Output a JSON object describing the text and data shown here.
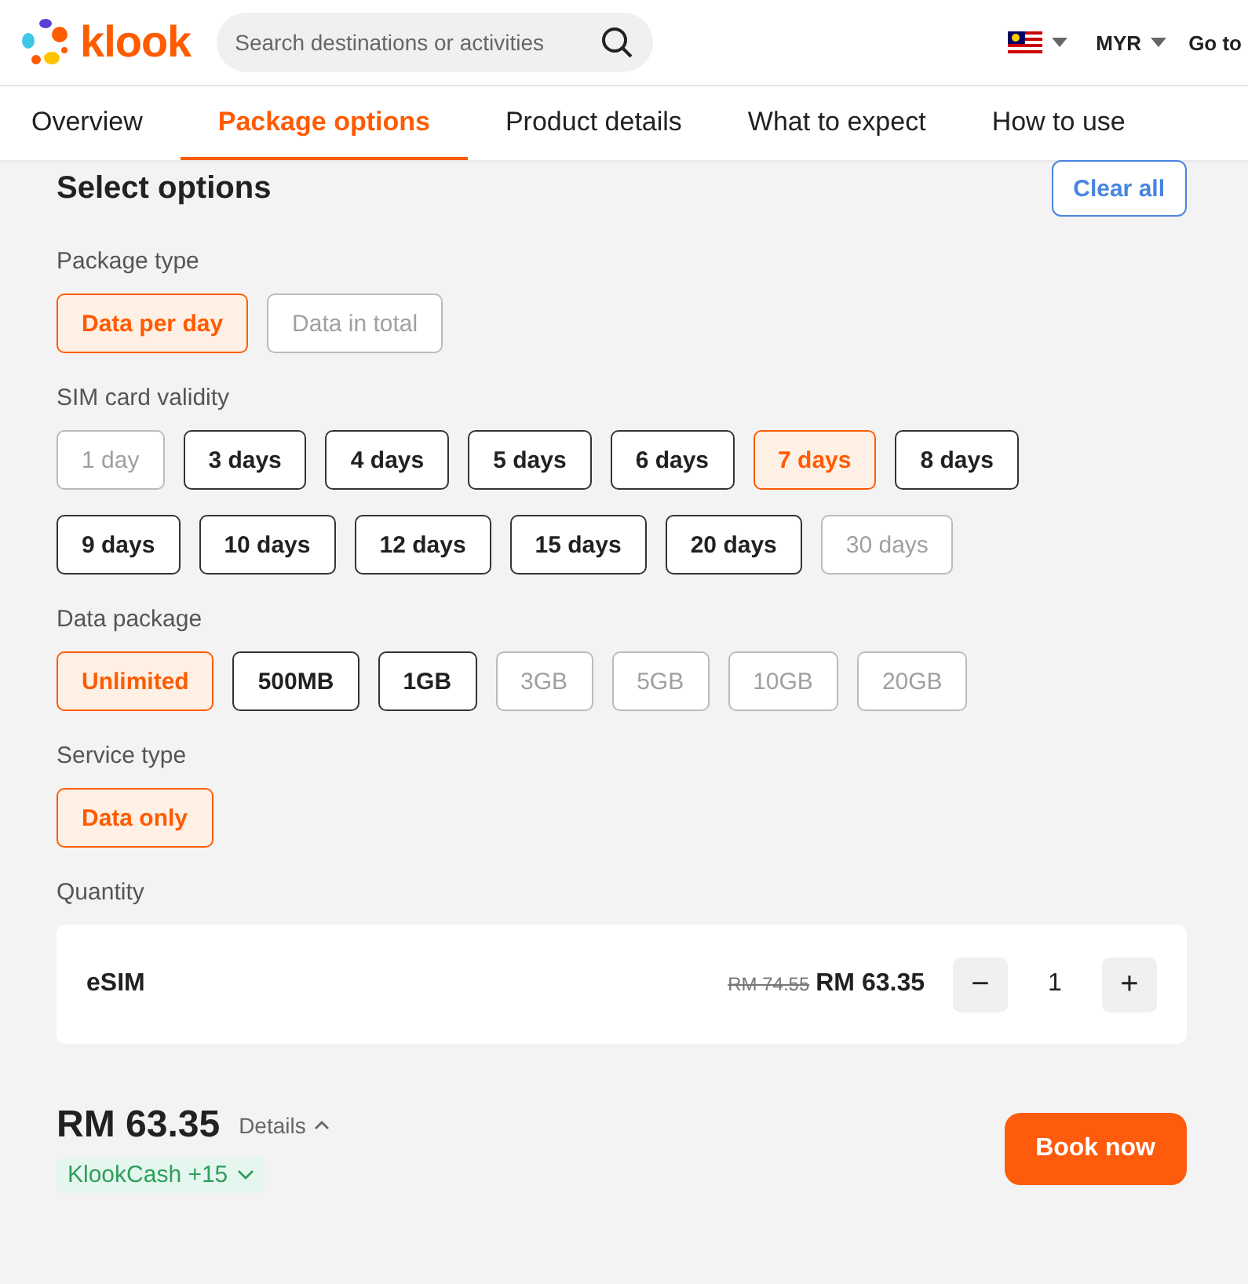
{
  "header": {
    "brand": "klook",
    "search": {
      "placeholder": "Search destinations or activities"
    },
    "currency": "MYR",
    "link": "Go to"
  },
  "tabs": [
    {
      "label": "Overview",
      "selected": false
    },
    {
      "label": "Package options",
      "selected": true
    },
    {
      "label": "Product details",
      "selected": false
    },
    {
      "label": "What to expect",
      "selected": false
    },
    {
      "label": "How to use",
      "selected": false
    }
  ],
  "title": "Select options",
  "clear_button": "Clear all",
  "groups": [
    {
      "label": "Package type",
      "options": [
        {
          "label": "Data per day",
          "selected": true,
          "disabled": false
        },
        {
          "label": "Data in total",
          "selected": false,
          "disabled": true
        }
      ]
    },
    {
      "label": "SIM card validity",
      "options": [
        {
          "label": "1 day",
          "selected": false,
          "disabled": true
        },
        {
          "label": "3 days",
          "selected": false,
          "disabled": false
        },
        {
          "label": "4 days",
          "selected": false,
          "disabled": false
        },
        {
          "label": "5 days",
          "selected": false,
          "disabled": false
        },
        {
          "label": "6 days",
          "selected": false,
          "disabled": false
        },
        {
          "label": "7 days",
          "selected": true,
          "disabled": false
        },
        {
          "label": "8 days",
          "selected": false,
          "disabled": false
        },
        {
          "label": "9 days",
          "selected": false,
          "disabled": false
        },
        {
          "label": "10 days",
          "selected": false,
          "disabled": false
        },
        {
          "label": "12 days",
          "selected": false,
          "disabled": false
        },
        {
          "label": "15 days",
          "selected": false,
          "disabled": false
        },
        {
          "label": "20 days",
          "selected": false,
          "disabled": false
        },
        {
          "label": "30 days",
          "selected": false,
          "disabled": true
        }
      ]
    },
    {
      "label": "Data package",
      "options": [
        {
          "label": "Unlimited",
          "selected": true,
          "disabled": false
        },
        {
          "label": "500MB",
          "selected": false,
          "disabled": false
        },
        {
          "label": "1GB",
          "selected": false,
          "disabled": false
        },
        {
          "label": "3GB",
          "selected": false,
          "disabled": true
        },
        {
          "label": "5GB",
          "selected": false,
          "disabled": true
        },
        {
          "label": "10GB",
          "selected": false,
          "disabled": true
        },
        {
          "label": "20GB",
          "selected": false,
          "disabled": true
        }
      ]
    },
    {
      "label": "Service type",
      "options": [
        {
          "label": "Data only",
          "selected": true,
          "disabled": false
        }
      ]
    }
  ],
  "quantity": {
    "label": "Quantity",
    "item": "eSIM",
    "old_price": "RM 74.55",
    "price": "RM 63.35",
    "minus": "−",
    "value": "1",
    "plus": "+"
  },
  "footer": {
    "total": "RM 63.35",
    "details": "Details",
    "cashback": "KlookCash +15",
    "book_button": "Book now"
  }
}
